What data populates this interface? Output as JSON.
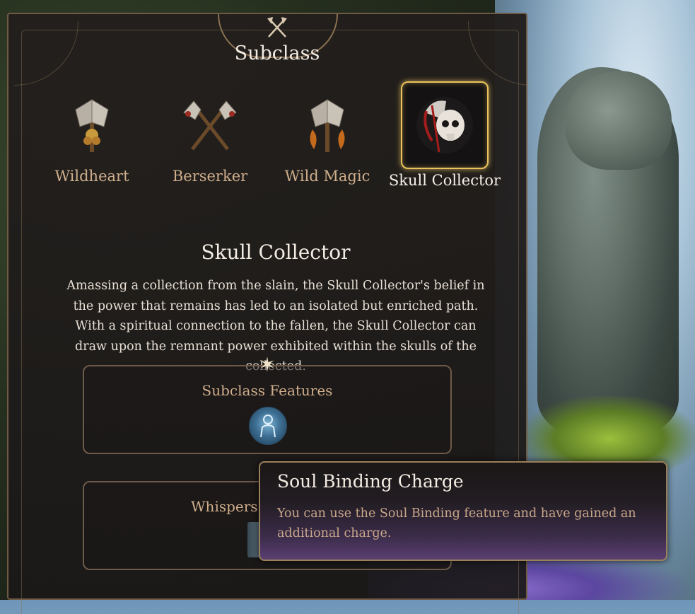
{
  "panel": {
    "title": "Subclass"
  },
  "subclasses": [
    {
      "label": "Wildheart",
      "selected": false
    },
    {
      "label": "Berserker",
      "selected": false
    },
    {
      "label": "Wild Magic",
      "selected": false
    },
    {
      "label": "Skull Collector",
      "selected": true
    }
  ],
  "detail": {
    "title": "Skull Collector",
    "description": "Amassing a collection from the slain, the Skull Collector's belief in the power that remains has led to an isolated but enriched path. With a spiritual connection to the fallen, the Skull Collector can draw upon the remnant power exhibited within the skulls of the collected."
  },
  "features": {
    "label": "Subclass Features",
    "icon": "soul-figure-icon"
  },
  "whispers": {
    "label": "Whispers"
  },
  "tooltip": {
    "title": "Soul Binding Charge",
    "description": "You can use the Soul Binding feature and have gained an additional charge."
  },
  "colors": {
    "accent_gold": "#e9c25e",
    "label_tan": "#cfae8c",
    "tooltip_purple": "#5a3f72"
  }
}
